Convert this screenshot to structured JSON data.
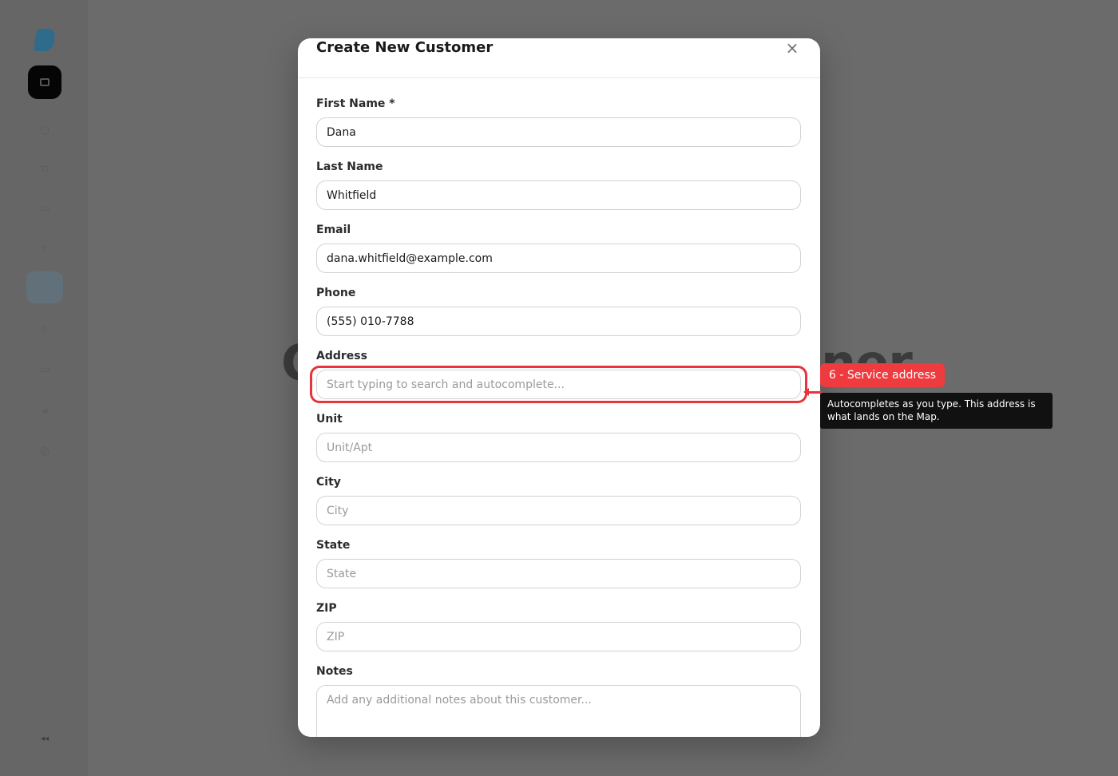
{
  "modal": {
    "title": "Create New Customer",
    "close_symbol": "×"
  },
  "fields": {
    "first_name": {
      "label": "First Name *",
      "value": "Dana",
      "placeholder": ""
    },
    "last_name": {
      "label": "Last Name",
      "value": "Whitfield",
      "placeholder": ""
    },
    "email": {
      "label": "Email",
      "value": "dana.whitfield@example.com",
      "placeholder": ""
    },
    "phone": {
      "label": "Phone",
      "value": "(555) 010-7788",
      "placeholder": ""
    },
    "address": {
      "label": "Address",
      "value": "",
      "placeholder": "Start typing to search and autocomplete..."
    },
    "unit": {
      "label": "Unit",
      "value": "",
      "placeholder": "Unit/Apt"
    },
    "city": {
      "label": "City",
      "value": "",
      "placeholder": "City"
    },
    "state": {
      "label": "State",
      "value": "",
      "placeholder": "State"
    },
    "zip": {
      "label": "ZIP",
      "value": "",
      "placeholder": "ZIP"
    },
    "notes": {
      "label": "Notes",
      "value": "",
      "placeholder": "Add any additional notes about this customer..."
    }
  },
  "tour": {
    "step_badge": "6 - Service address",
    "tooltip": "Autocompletes as you type. This address is what lands on the Map.",
    "accent_color": "#ee3b3f"
  },
  "background": {
    "heading_left": "C",
    "heading_right": "ner"
  },
  "icons": {
    "close": "close-icon",
    "sidebar_logo": "logo-icon"
  }
}
